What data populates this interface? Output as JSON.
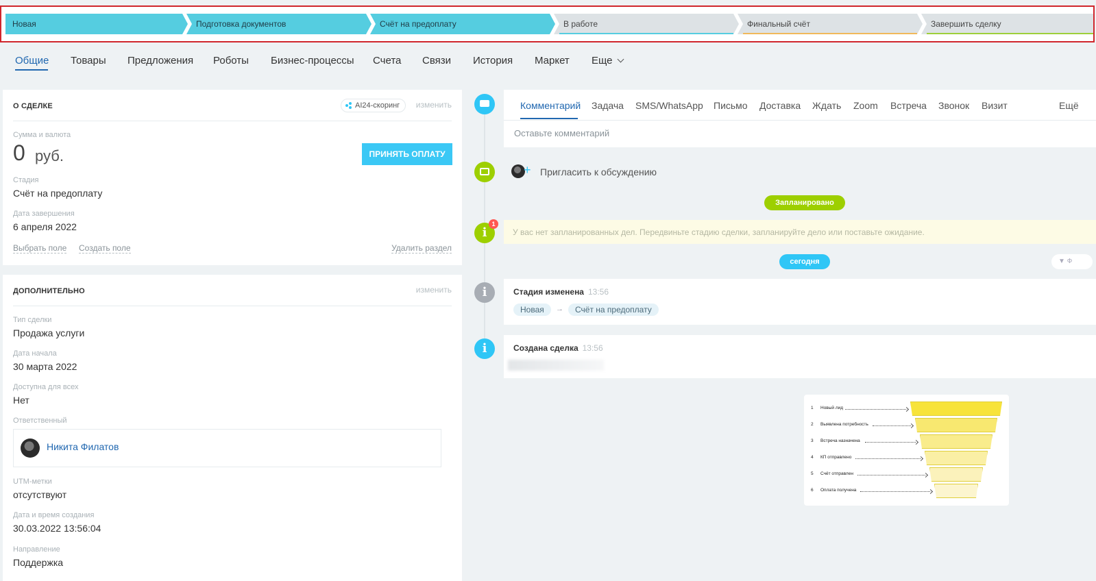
{
  "stages": [
    {
      "label": "Новая",
      "active": true
    },
    {
      "label": "Подготовка документов",
      "active": true
    },
    {
      "label": "Счёт на предоплату",
      "active": true
    },
    {
      "label": "В работе",
      "active": false,
      "underline": "#55cde0"
    },
    {
      "label": "Финальный счёт",
      "active": false,
      "underline": "#f0b85a"
    },
    {
      "label": "Завершить сделку",
      "active": false,
      "underline": "#9ecf3a"
    }
  ],
  "tabs": [
    "Общие",
    "Товары",
    "Предложения",
    "Роботы",
    "Бизнес-процессы",
    "Счета",
    "Связи",
    "История",
    "Маркет",
    "Еще"
  ],
  "about": {
    "title": "О сделке",
    "ai_scoring": "AI24-скоринг",
    "edit": "изменить",
    "sum_label": "Сумма и валюта",
    "sum_amount": "0",
    "sum_currency": "руб.",
    "pay_button": "ПРИНЯТЬ ОПЛАТУ",
    "stage_label": "Стадия",
    "stage_value": "Счёт на предоплату",
    "close_date_label": "Дата завершения",
    "close_date_value": "6 апреля 2022",
    "choose_field": "Выбрать поле",
    "create_field": "Создать поле",
    "delete_section": "Удалить раздел"
  },
  "extra": {
    "title": "Дополнительно",
    "edit": "изменить",
    "deal_type_label": "Тип сделки",
    "deal_type_value": "Продажа услуги",
    "start_date_label": "Дата начала",
    "start_date_value": "30 марта 2022",
    "public_label": "Доступна для всех",
    "public_value": "Нет",
    "responsible_label": "Ответственный",
    "responsible_name": "Никита Филатов",
    "utm_label": "UTM-метки",
    "utm_value": "отсутствуют",
    "created_label": "Дата и время создания",
    "created_value": "30.03.2022 13:56:04",
    "direction_label": "Направление",
    "direction_value": "Поддержка"
  },
  "composer": {
    "tabs": [
      "Комментарий",
      "Задача",
      "SMS/WhatsApp",
      "Письмо",
      "Доставка",
      "Ждать",
      "Zoom",
      "Встреча",
      "Звонок",
      "Визит",
      "Ещё"
    ],
    "placeholder": "Оставьте комментарий"
  },
  "timeline": {
    "invite": "Пригласить к обсуждению",
    "planned_pill": "Запланировано",
    "warning_badge": "1",
    "warning_text": "У вас нет запланированных дел. Передвиньте стадию сделки, запланируйте дело или поставьте ожидание.",
    "today_pill": "сегодня",
    "filter_label": "Ф",
    "stage_changed_title": "Стадия изменена",
    "stage_changed_time": "13:56",
    "from_stage": "Новая",
    "arrow": "→",
    "to_stage": "Счёт на предоплату",
    "created_title": "Создана сделка",
    "created_time": "13:56"
  },
  "funnel": {
    "rows": [
      {
        "num": "1",
        "label": "Новый лид"
      },
      {
        "num": "2",
        "label": "Выявлена потребность"
      },
      {
        "num": "3",
        "label": "Встреча назначена"
      },
      {
        "num": "4",
        "label": "КП отправлено"
      },
      {
        "num": "5",
        "label": "Счёт отправлен"
      },
      {
        "num": "6",
        "label": "Оплата получена"
      }
    ],
    "colors": [
      "#f7e33a",
      "#f8e870",
      "#f9ec8c",
      "#faefa5",
      "#fbf2bb",
      "#fcf5cf"
    ]
  },
  "colors": {
    "accent_blue": "#2067b0",
    "stage_active": "#55cde0",
    "timeline_green": "#9dcf00",
    "timeline_blue": "#2fc6f6",
    "timeline_gray": "#a8adb4"
  }
}
